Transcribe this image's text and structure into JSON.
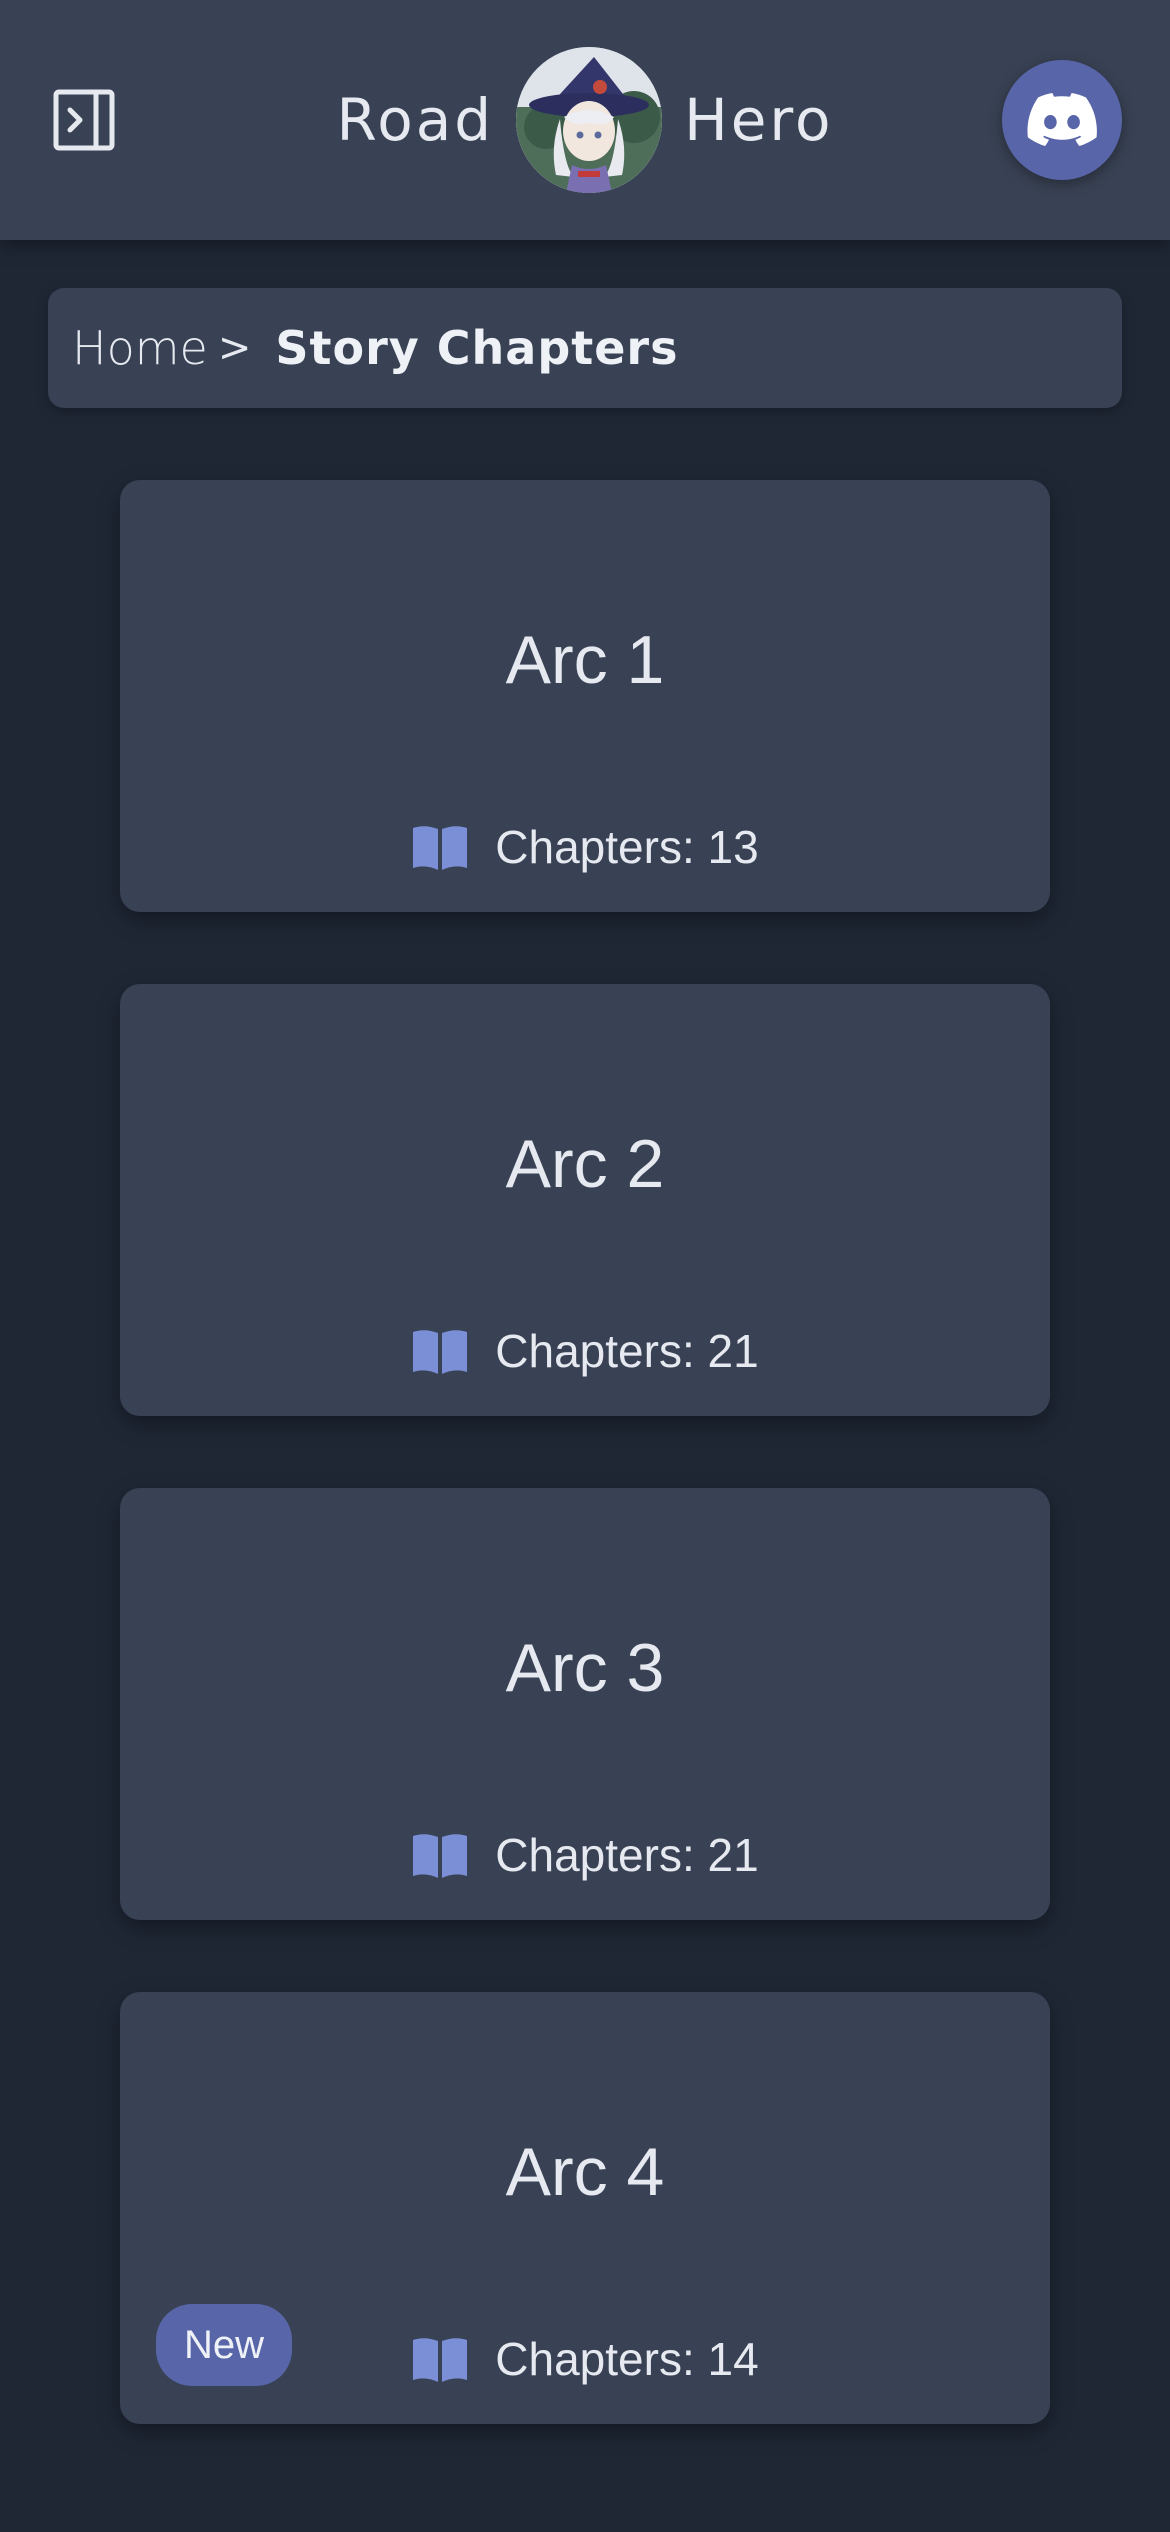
{
  "header": {
    "brand_left": "Road",
    "brand_right": "Hero",
    "toggle_icon": "sidebar-toggle-icon",
    "discord_icon": "discord-icon",
    "discord_color": "#5865a8"
  },
  "breadcrumb": {
    "home": "Home",
    "separator": ">",
    "current": "Story Chapters"
  },
  "arcs": [
    {
      "title": "Arc 1",
      "chapters_text": "Chapters: 13",
      "icon": "book-icon"
    },
    {
      "title": "Arc 2",
      "chapters_text": "Chapters: 21",
      "icon": "book-icon"
    },
    {
      "title": "Arc 3",
      "chapters_text": "Chapters: 21",
      "icon": "book-icon"
    },
    {
      "title": "Arc 4",
      "chapters_text": "Chapters: 14",
      "icon": "book-icon",
      "badge": "New"
    }
  ],
  "colors": {
    "background": "#1f2735",
    "surface": "#394254",
    "accent": "#7b8fd6",
    "badge": "#5865a8"
  }
}
